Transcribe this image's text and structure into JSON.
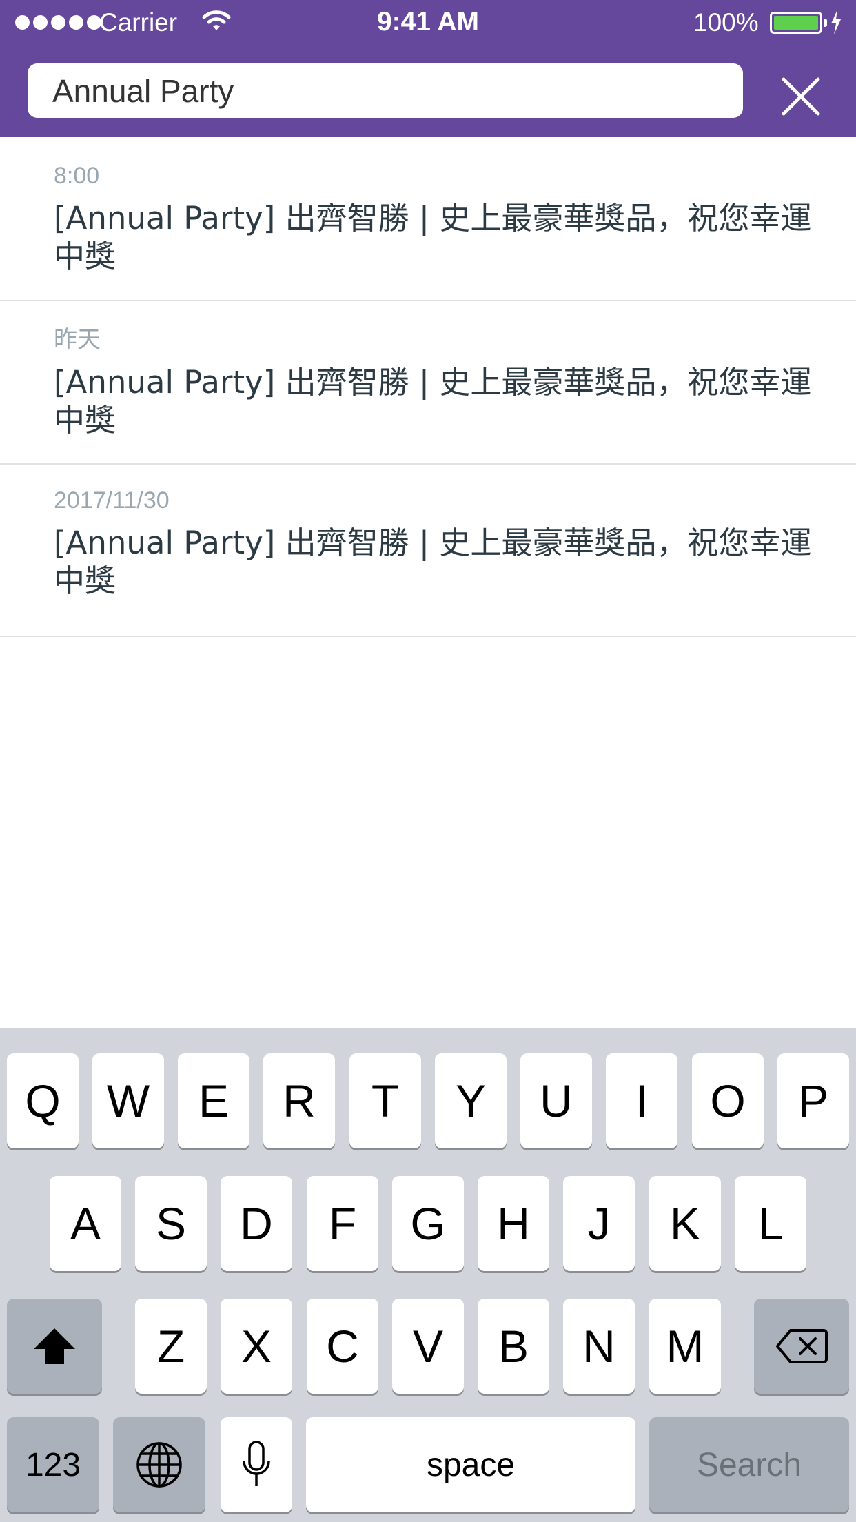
{
  "status_bar": {
    "carrier": "Carrier",
    "time": "9:41 AM",
    "battery_percent": "100%",
    "battery_color": "#5ed04e"
  },
  "header": {
    "background": "#65479b",
    "search_value": "Annual Party",
    "close_icon": "close-icon"
  },
  "results": [
    {
      "date": "8:00",
      "title": "[Annual Party] 出齊智勝 | 史上最豪華獎品，祝您幸運中獎"
    },
    {
      "date": "昨天",
      "title": "[Annual Party] 出齊智勝 | 史上最豪華獎品，祝您幸運中獎"
    },
    {
      "date": "2017/11/30",
      "title": "[Annual Party] 出齊智勝 | 史上最豪華獎品，祝您幸運中獎"
    }
  ],
  "keyboard": {
    "row1": [
      "Q",
      "W",
      "E",
      "R",
      "T",
      "Y",
      "U",
      "I",
      "O",
      "P"
    ],
    "row2": [
      "A",
      "S",
      "D",
      "F",
      "G",
      "H",
      "J",
      "K",
      "L"
    ],
    "row3": [
      "Z",
      "X",
      "C",
      "V",
      "B",
      "N",
      "M"
    ],
    "shift_icon": "shift-icon",
    "backspace_icon": "backspace-icon",
    "numbers_label": "123",
    "globe_icon": "globe-icon",
    "mic_icon": "microphone-icon",
    "space_label": "space",
    "search_label": "Search"
  }
}
